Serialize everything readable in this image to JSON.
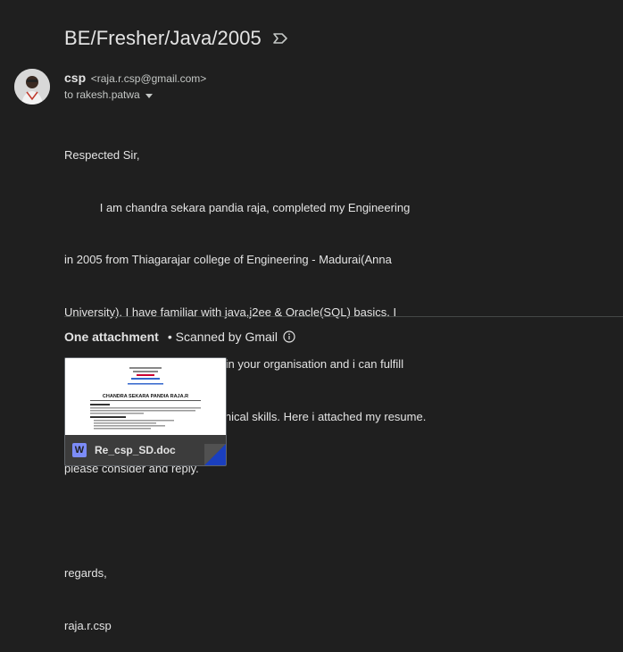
{
  "email": {
    "subject": "BE/Fresher/Java/2005",
    "sender_name": "csp",
    "sender_email": "<raja.r.csp@gmail.com>",
    "recipient": "to rakesh.patwa",
    "body_lines": [
      "Respected Sir,",
      "           I am chandra sekara pandia raja, completed my Engineering",
      "in 2005 from Thiagarajar college of Engineering - Madurai(Anna",
      "University). I have familiar with java,j2ee & Oracle(SQL) basics. I",
      "came to know some vacancies in your organisation and i can fulfill",
      "your needs with my strong technical skills. Here i attached my resume.",
      "please consider and reply.",
      "",
      "regards,",
      "raja.r.csp"
    ]
  },
  "attachments": {
    "header": "One attachment",
    "scanned": "• Scanned by Gmail",
    "file_icon": "word-doc-icon",
    "file_icon_letter": "W",
    "filename": "Re_csp_SD.doc",
    "preview_title": "CHANDRA SEKARA PANDIA RAJA.R"
  },
  "colors": {
    "background": "#1f1f1f",
    "text": "#e3e3e3",
    "muted": "#c4c7c5",
    "word_icon": "#7c8cf8",
    "corner_blue": "#1a3fbf"
  }
}
